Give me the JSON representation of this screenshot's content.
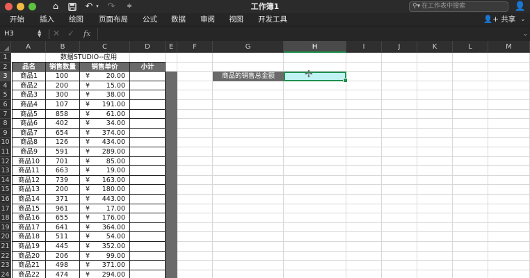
{
  "window": {
    "title": "工作簿1",
    "search_placeholder": "在工作表中搜索",
    "share_label": "共享"
  },
  "toolbar_icons": [
    "home-icon",
    "save-icon",
    "undo-icon",
    "redo-icon",
    "customize-icon"
  ],
  "ribbon": {
    "tabs": [
      "开始",
      "插入",
      "绘图",
      "页面布局",
      "公式",
      "数据",
      "审阅",
      "视图",
      "开发工具"
    ]
  },
  "formula_bar": {
    "name_box": "H3",
    "fx_label": "fx",
    "content": ""
  },
  "columns": [
    "A",
    "B",
    "C",
    "D",
    "E",
    "F",
    "G",
    "H",
    "I",
    "J",
    "K",
    "L",
    "M"
  ],
  "selected_column": "H",
  "rows": [
    "1",
    "2",
    "3",
    "4",
    "5",
    "6",
    "7",
    "8",
    "9",
    "10",
    "11",
    "12",
    "13",
    "14",
    "15",
    "16",
    "17",
    "18",
    "19",
    "20",
    "21",
    "22",
    "23",
    "24"
  ],
  "selected_row": "3",
  "sheet": {
    "title": "数据STUDIO--应用",
    "headers": [
      "品名",
      "销售数量",
      "销售单价",
      "小计"
    ],
    "currency": "¥",
    "items": [
      {
        "name": "商品1",
        "qty": "100",
        "price": "20.00"
      },
      {
        "name": "商品2",
        "qty": "200",
        "price": "15.00"
      },
      {
        "name": "商品3",
        "qty": "300",
        "price": "38.00"
      },
      {
        "name": "商品4",
        "qty": "107",
        "price": "191.00"
      },
      {
        "name": "商品5",
        "qty": "858",
        "price": "61.00"
      },
      {
        "name": "商品6",
        "qty": "402",
        "price": "34.00"
      },
      {
        "name": "商品7",
        "qty": "654",
        "price": "374.00"
      },
      {
        "name": "商品8",
        "qty": "126",
        "price": "434.00"
      },
      {
        "name": "商品9",
        "qty": "591",
        "price": "289.00"
      },
      {
        "name": "商品10",
        "qty": "701",
        "price": "85.00"
      },
      {
        "name": "商品11",
        "qty": "663",
        "price": "19.00"
      },
      {
        "name": "商品12",
        "qty": "739",
        "price": "163.00"
      },
      {
        "name": "商品13",
        "qty": "200",
        "price": "180.00"
      },
      {
        "name": "商品14",
        "qty": "371",
        "price": "443.00"
      },
      {
        "name": "商品15",
        "qty": "961",
        "price": "17.00"
      },
      {
        "name": "商品16",
        "qty": "655",
        "price": "176.00"
      },
      {
        "name": "商品17",
        "qty": "641",
        "price": "364.00"
      },
      {
        "name": "商品18",
        "qty": "511",
        "price": "54.00"
      },
      {
        "name": "商品19",
        "qty": "445",
        "price": "352.00"
      },
      {
        "name": "商品20",
        "qty": "206",
        "price": "99.00"
      },
      {
        "name": "商品21",
        "qty": "498",
        "price": "371.00"
      },
      {
        "name": "商品22",
        "qty": "474",
        "price": "294.00"
      }
    ],
    "summary_label": "商品的销售总金额",
    "summary_value": ""
  },
  "colors": {
    "accent": "#1f8f4e",
    "header_fill": "#6a6a6a",
    "active_fill": "#bff3f3"
  }
}
